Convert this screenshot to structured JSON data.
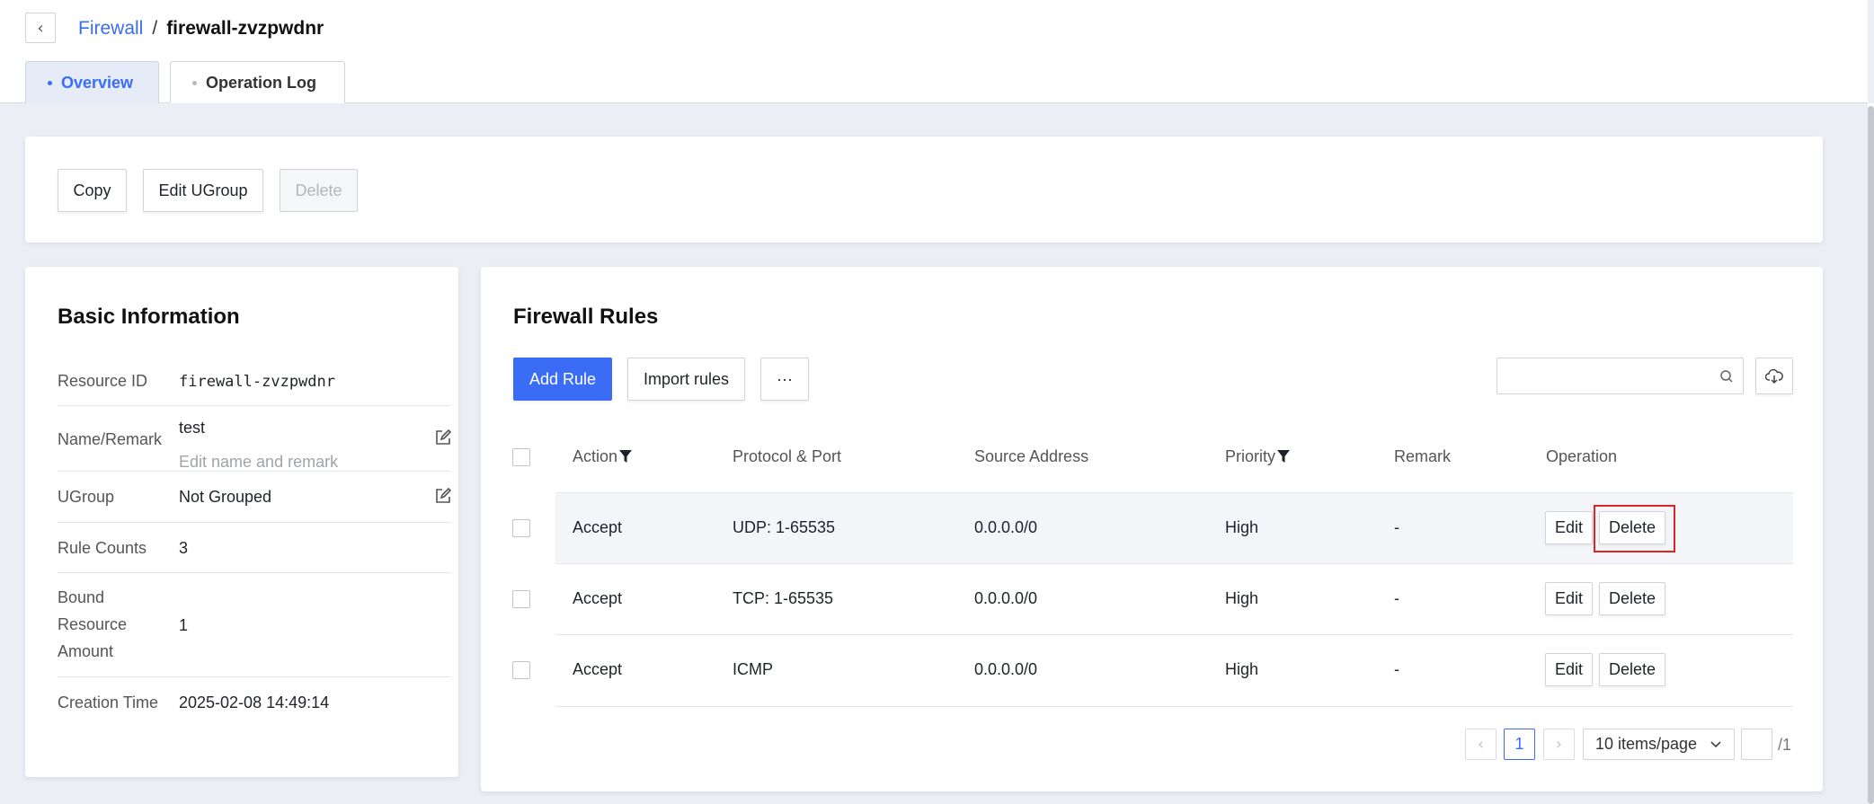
{
  "header": {
    "breadcrumb_parent": "Firewall",
    "breadcrumb_sep": "/",
    "breadcrumb_current": "firewall-zvzpwdnr",
    "tabs": [
      {
        "label": "Overview",
        "active": true
      },
      {
        "label": "Operation Log",
        "active": false
      }
    ]
  },
  "actions": {
    "copy": "Copy",
    "edit_ugroup": "Edit UGroup",
    "delete": "Delete"
  },
  "basic_info": {
    "title": "Basic Information",
    "resource_id_label": "Resource ID",
    "resource_id": "firewall-zvzpwdnr",
    "name_label": "Name/Remark",
    "name": "test",
    "remark_hint": "Edit name and remark",
    "ugroup_label": "UGroup",
    "ugroup": "Not Grouped",
    "rule_counts_label": "Rule Counts",
    "rule_counts": "3",
    "bound_label_1": "Bound",
    "bound_label_2": "Resource",
    "bound_label_3": "Amount",
    "bound_amount": "1",
    "creation_label": "Creation Time",
    "creation_time": "2025-02-08 14:49:14"
  },
  "rules": {
    "title": "Firewall Rules",
    "add_rule": "Add Rule",
    "import_rules": "Import rules",
    "more": "···",
    "search_placeholder": "",
    "columns": {
      "action": "Action",
      "protocol": "Protocol & Port",
      "source": "Source Address",
      "priority": "Priority",
      "remark": "Remark",
      "operation": "Operation"
    },
    "rows": [
      {
        "action": "Accept",
        "protocol": "UDP: 1-65535",
        "source": "0.0.0.0/0",
        "priority": "High",
        "remark": "-",
        "edit": "Edit",
        "delete": "Delete"
      },
      {
        "action": "Accept",
        "protocol": "TCP: 1-65535",
        "source": "0.0.0.0/0",
        "priority": "High",
        "remark": "-",
        "edit": "Edit",
        "delete": "Delete"
      },
      {
        "action": "Accept",
        "protocol": "ICMP",
        "source": "0.0.0.0/0",
        "priority": "High",
        "remark": "-",
        "edit": "Edit",
        "delete": "Delete"
      }
    ],
    "pagination": {
      "current_page": "1",
      "page_size": "10 items/page",
      "total_pages": "/1"
    }
  },
  "colors": {
    "accent": "#3b6cf6",
    "highlight": "#e02424"
  }
}
